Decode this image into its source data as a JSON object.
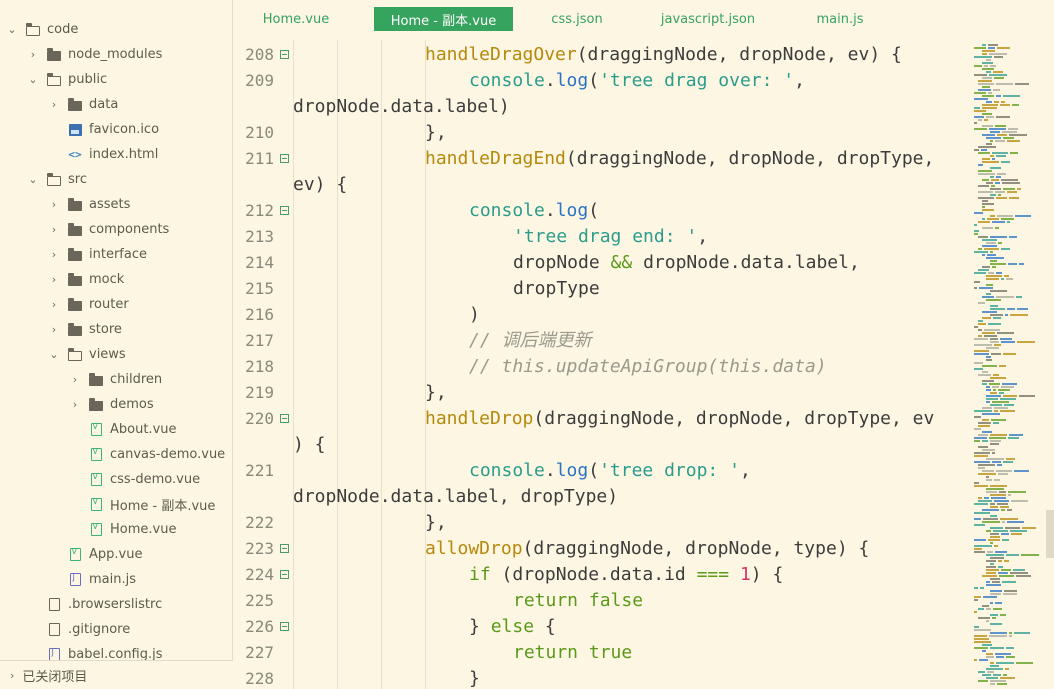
{
  "sidebar": {
    "rows": [
      {
        "label": "code",
        "type": "folder-open",
        "depth": 0,
        "chev": "⌄"
      },
      {
        "label": "node_modules",
        "type": "folder",
        "depth": 1,
        "chev": "›"
      },
      {
        "label": "public",
        "type": "folder-open",
        "depth": 1,
        "chev": "⌄"
      },
      {
        "label": "data",
        "type": "folder",
        "depth": 2,
        "chev": "›"
      },
      {
        "label": "favicon.ico",
        "type": "img",
        "depth": 2,
        "chev": ""
      },
      {
        "label": "index.html",
        "type": "html",
        "depth": 2,
        "chev": ""
      },
      {
        "label": "src",
        "type": "folder-open",
        "depth": 1,
        "chev": "⌄"
      },
      {
        "label": "assets",
        "type": "folder",
        "depth": 2,
        "chev": "›"
      },
      {
        "label": "components",
        "type": "folder",
        "depth": 2,
        "chev": "›"
      },
      {
        "label": "interface",
        "type": "folder",
        "depth": 2,
        "chev": "›"
      },
      {
        "label": "mock",
        "type": "folder",
        "depth": 2,
        "chev": "›"
      },
      {
        "label": "router",
        "type": "folder",
        "depth": 2,
        "chev": "›"
      },
      {
        "label": "store",
        "type": "folder",
        "depth": 2,
        "chev": "›"
      },
      {
        "label": "views",
        "type": "folder-open",
        "depth": 2,
        "chev": "⌄"
      },
      {
        "label": "children",
        "type": "folder",
        "depth": 3,
        "chev": "›"
      },
      {
        "label": "demos",
        "type": "folder",
        "depth": 3,
        "chev": "›"
      },
      {
        "label": "About.vue",
        "type": "vue",
        "depth": 3,
        "chev": ""
      },
      {
        "label": "canvas-demo.vue",
        "type": "vue",
        "depth": 3,
        "chev": ""
      },
      {
        "label": "css-demo.vue",
        "type": "vue",
        "depth": 3,
        "chev": ""
      },
      {
        "label": "Home - 副本.vue",
        "type": "vue",
        "depth": 3,
        "chev": ""
      },
      {
        "label": "Home.vue",
        "type": "vue",
        "depth": 3,
        "chev": ""
      },
      {
        "label": "App.vue",
        "type": "vue",
        "depth": 2,
        "chev": ""
      },
      {
        "label": "main.js",
        "type": "js",
        "depth": 2,
        "chev": ""
      },
      {
        "label": ".browserslistrc",
        "type": "plain",
        "depth": 1,
        "chev": ""
      },
      {
        "label": ".gitignore",
        "type": "plain",
        "depth": 1,
        "chev": ""
      },
      {
        "label": "babel.config.js",
        "type": "js",
        "depth": 1,
        "chev": ""
      }
    ],
    "closed_section": {
      "label": "已关闭项目",
      "chev": "›"
    }
  },
  "tabs": [
    {
      "label": "Home.vue",
      "active": false
    },
    {
      "label": "Home - 副本.vue",
      "active": true
    },
    {
      "label": "css.json",
      "active": false
    },
    {
      "label": "javascript.json",
      "active": false
    },
    {
      "label": "main.js",
      "active": false
    }
  ],
  "editor": {
    "lines": [
      {
        "num": "208",
        "fold": true,
        "indent": 3,
        "tokens": [
          [
            "handleDragOver",
            "fn"
          ],
          [
            "(draggingNode, dropNode, ev) {",
            "p"
          ]
        ]
      },
      {
        "num": "209",
        "fold": false,
        "indent": 4,
        "tokens": [
          [
            "console",
            "obj"
          ],
          [
            ".",
            "p"
          ],
          [
            "log",
            "meth"
          ],
          [
            "(",
            "p"
          ],
          [
            "'tree drag over: '",
            "str"
          ],
          [
            ",",
            "p"
          ]
        ]
      },
      {
        "num": "",
        "fold": false,
        "indent": 0,
        "tokens": [
          [
            "dropNode.data.label)",
            "p"
          ]
        ]
      },
      {
        "num": "210",
        "fold": false,
        "indent": 3,
        "tokens": [
          [
            "},",
            "p"
          ]
        ]
      },
      {
        "num": "211",
        "fold": true,
        "indent": 3,
        "tokens": [
          [
            "handleDragEnd",
            "fn"
          ],
          [
            "(draggingNode, dropNode, dropType,",
            "p"
          ]
        ]
      },
      {
        "num": "",
        "fold": false,
        "indent": 0,
        "tokens": [
          [
            "ev) {",
            "p"
          ]
        ]
      },
      {
        "num": "212",
        "fold": true,
        "indent": 4,
        "tokens": [
          [
            "console",
            "obj"
          ],
          [
            ".",
            "p"
          ],
          [
            "log",
            "meth"
          ],
          [
            "(",
            "p"
          ]
        ]
      },
      {
        "num": "213",
        "fold": false,
        "indent": 5,
        "tokens": [
          [
            "'tree drag end: '",
            "str"
          ],
          [
            ",",
            "p"
          ]
        ]
      },
      {
        "num": "214",
        "fold": false,
        "indent": 5,
        "tokens": [
          [
            "dropNode ",
            "p"
          ],
          [
            "&&",
            "op"
          ],
          [
            " dropNode.data.label,",
            "p"
          ]
        ]
      },
      {
        "num": "215",
        "fold": false,
        "indent": 5,
        "tokens": [
          [
            "dropType",
            "p"
          ]
        ]
      },
      {
        "num": "216",
        "fold": false,
        "indent": 4,
        "tokens": [
          [
            ")",
            "p"
          ]
        ]
      },
      {
        "num": "217",
        "fold": false,
        "indent": 4,
        "tokens": [
          [
            "// 调后端更新",
            "cmt"
          ]
        ]
      },
      {
        "num": "218",
        "fold": false,
        "indent": 4,
        "tokens": [
          [
            "// this.updateApiGroup(this.data)",
            "cmt"
          ]
        ]
      },
      {
        "num": "219",
        "fold": false,
        "indent": 3,
        "tokens": [
          [
            "},",
            "p"
          ]
        ]
      },
      {
        "num": "220",
        "fold": true,
        "indent": 3,
        "tokens": [
          [
            "handleDrop",
            "fn"
          ],
          [
            "(draggingNode, dropNode, dropType, ev",
            "p"
          ]
        ]
      },
      {
        "num": "",
        "fold": false,
        "indent": 0,
        "tokens": [
          [
            ") {",
            "p"
          ]
        ]
      },
      {
        "num": "221",
        "fold": false,
        "indent": 4,
        "tokens": [
          [
            "console",
            "obj"
          ],
          [
            ".",
            "p"
          ],
          [
            "log",
            "meth"
          ],
          [
            "(",
            "p"
          ],
          [
            "'tree drop: '",
            "str"
          ],
          [
            ",",
            "p"
          ]
        ]
      },
      {
        "num": "",
        "fold": false,
        "indent": 0,
        "tokens": [
          [
            "dropNode.data.label, dropType)",
            "p"
          ]
        ]
      },
      {
        "num": "222",
        "fold": false,
        "indent": 3,
        "tokens": [
          [
            "},",
            "p"
          ]
        ]
      },
      {
        "num": "223",
        "fold": true,
        "indent": 3,
        "tokens": [
          [
            "allowDrop",
            "fn"
          ],
          [
            "(draggingNode, dropNode, type) {",
            "p"
          ]
        ]
      },
      {
        "num": "224",
        "fold": true,
        "indent": 4,
        "tokens": [
          [
            "if",
            "kw"
          ],
          [
            " (dropNode.data.id ",
            "p"
          ],
          [
            "===",
            "op"
          ],
          [
            " ",
            "p"
          ],
          [
            "1",
            "num"
          ],
          [
            ") {",
            "p"
          ]
        ]
      },
      {
        "num": "225",
        "fold": false,
        "indent": 5,
        "tokens": [
          [
            "return",
            "kw"
          ],
          [
            " ",
            "p"
          ],
          [
            "false",
            "kw"
          ]
        ]
      },
      {
        "num": "226",
        "fold": true,
        "indent": 4,
        "tokens": [
          [
            "} ",
            "p"
          ],
          [
            "else",
            "kw"
          ],
          [
            " {",
            "p"
          ]
        ]
      },
      {
        "num": "227",
        "fold": false,
        "indent": 5,
        "tokens": [
          [
            "return",
            "kw"
          ],
          [
            " ",
            "p"
          ],
          [
            "true",
            "kw"
          ]
        ]
      },
      {
        "num": "228",
        "fold": false,
        "indent": 4,
        "tokens": [
          [
            "}",
            "p"
          ]
        ]
      }
    ]
  },
  "colors": {
    "background": "#fdf6e3",
    "accent": "#36a35f",
    "function": "#b5890b",
    "string": "#2a9c8c",
    "keyword": "#5a9a1a",
    "method": "#2a72c4",
    "number": "#d23669",
    "comment": "#9a9a8c"
  }
}
